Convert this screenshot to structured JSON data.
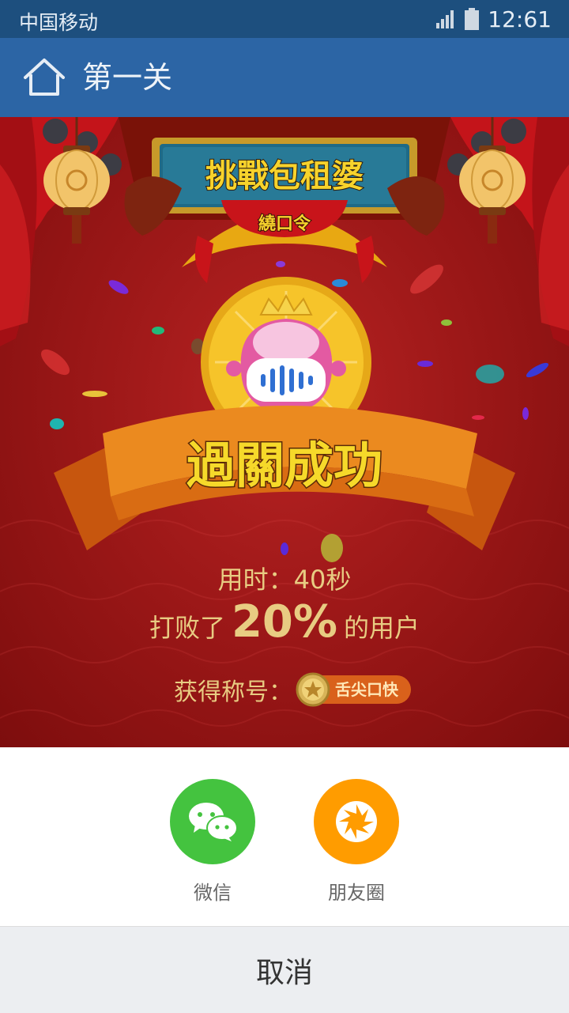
{
  "status_bar": {
    "carrier": "中国移动",
    "time": "12:61",
    "icons": [
      "signal-icon",
      "battery-icon"
    ]
  },
  "nav": {
    "title": "第一关",
    "home_icon": "home-icon"
  },
  "stage": {
    "sign_title": "挑戰包租婆",
    "sign_subtitle": "繞口令",
    "banner_text": "過關成功",
    "time_used": "用时：40秒",
    "beat_prefix": "打败了",
    "beat_percent": "20%",
    "beat_suffix": "的用户",
    "title_label": "获得称号：",
    "title_badge": "舌尖口快"
  },
  "share": {
    "items": [
      {
        "label": "微信",
        "icon": "wechat-icon",
        "color": "#44c33f"
      },
      {
        "label": "朋友圈",
        "icon": "moments-icon",
        "color": "#ff9c00"
      }
    ]
  },
  "cancel_label": "取消",
  "colors": {
    "status_bar": "#1d4f7e",
    "nav_bar": "#2c65a5",
    "stage_red": "#9d1818",
    "gold_text": "#e8cc82",
    "banner_orange": "#e07a1c"
  }
}
